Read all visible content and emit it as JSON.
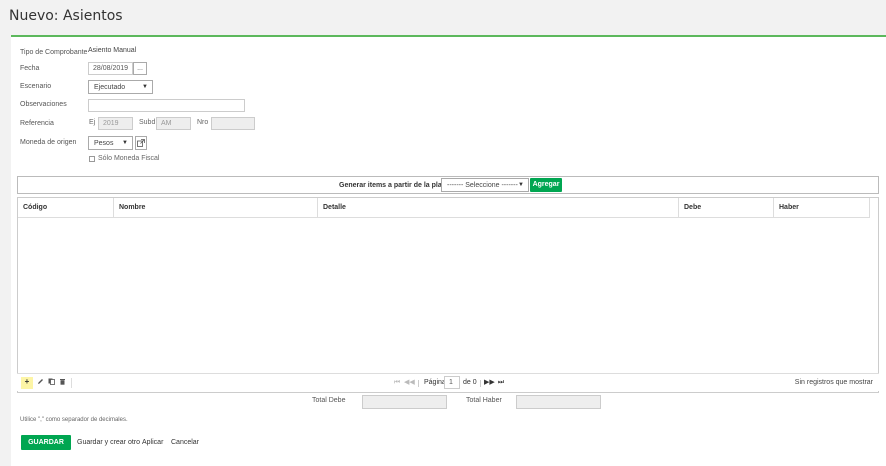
{
  "page": {
    "title": "Nuevo: Asientos"
  },
  "form": {
    "tipo_label": "Tipo de Comprobante",
    "tipo_value": "Asiento Manual",
    "fecha_label": "Fecha",
    "fecha_value": "28/08/2019",
    "fecha_btn": "...",
    "escenario_label": "Escenario",
    "escenario_value": "Ejecutado",
    "observaciones_label": "Observaciones",
    "observaciones_value": "",
    "referencia_label": "Referencia",
    "ej_label": "Ej",
    "ej_value": "2019",
    "subd_label": "Subd",
    "subd_value": "AM",
    "nro_label": "Nro",
    "nro_value": "",
    "moneda_label": "Moneda de origen",
    "moneda_value": "Pesos",
    "solo_moneda_label": "Sólo Moneda Fiscal"
  },
  "template": {
    "label": "Generar items a partir de la plantilla",
    "select_value": "------- Seleccione -------",
    "add_label": "Agregar"
  },
  "grid": {
    "columns": [
      "Código",
      "Nombre",
      "Detalle",
      "Debe",
      "Haber"
    ]
  },
  "pager": {
    "page_label": "Página",
    "page_value": "1",
    "of_label": "de 0",
    "no_records": "Sin registros que mostrar"
  },
  "totals": {
    "debe_label": "Total Debe",
    "haber_label": "Total Haber"
  },
  "note": "Utilice \",\" como separador de decimales.",
  "actions": {
    "save": "GUARDAR",
    "save_new": "Guardar y crear otro",
    "apply": "Aplicar",
    "cancel": "Cancelar"
  },
  "colors": {
    "accent": "#00a651",
    "panel_top": "#5cb85c"
  }
}
